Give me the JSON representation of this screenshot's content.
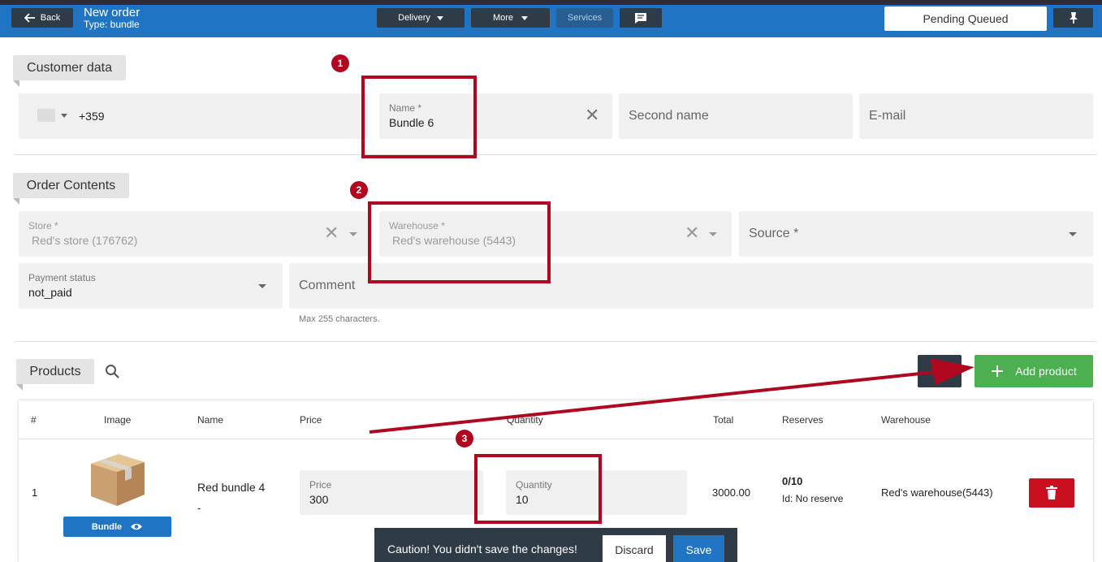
{
  "header": {
    "back_label": "Back",
    "title": "New order",
    "subtitle": "Type: bundle",
    "delivery_label": "Delivery",
    "more_label": "More",
    "services_label": "Services",
    "status": "Pending Queued"
  },
  "customer": {
    "section_label": "Customer data",
    "phone_code": "+359",
    "name_label": "Name *",
    "name_value": "Bundle 6",
    "second_name_placeholder": "Second name",
    "email_placeholder": "E-mail"
  },
  "order": {
    "section_label": "Order Contents",
    "store_label": "Store *",
    "store_value": "Red's store (176762)",
    "warehouse_label": "Warehouse *",
    "warehouse_value": "Red's warehouse (5443)",
    "source_placeholder": "Source *",
    "payment_label": "Payment status",
    "payment_value": "not_paid",
    "comment_placeholder": "Comment",
    "comment_hint": "Max 255 characters."
  },
  "products": {
    "section_label": "Products",
    "add_label": "Add product",
    "columns": [
      "#",
      "Image",
      "Name",
      "Price",
      "Quantity",
      "Total",
      "Reserves",
      "Warehouse"
    ],
    "rows": [
      {
        "index": "1",
        "name": "Red bundle 4",
        "name_sub": "-",
        "image_button": "Bundle",
        "price_label": "Price",
        "price_value": "300",
        "quantity_label": "Quantity",
        "quantity_value": "10",
        "total": "3000.00",
        "reserves": "0/10",
        "reserve_id": "Id: No reserve",
        "warehouse": "Red's warehouse(5443)"
      }
    ]
  },
  "annotations": [
    "1",
    "2",
    "3"
  ],
  "caution": {
    "text": "Caution! You didn't save the changes!",
    "discard_label": "Discard",
    "save_label": "Save"
  },
  "colors": {
    "header": "#1f75c4",
    "accent_red": "#b00720",
    "add_green": "#4caf50",
    "dark": "#2f3b47"
  }
}
